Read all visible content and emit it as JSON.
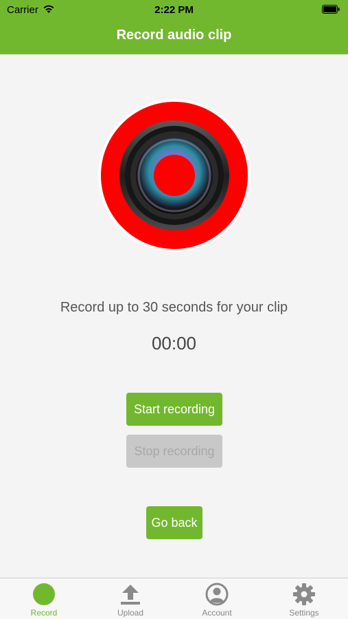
{
  "status_bar": {
    "carrier": "Carrier",
    "time": "2:22 PM"
  },
  "header": {
    "title": "Record audio clip"
  },
  "main": {
    "instruction": "Record up to 30 seconds for your clip",
    "timer": "00:00",
    "start_label": "Start recording",
    "stop_label": "Stop recording",
    "back_label": "Go back"
  },
  "tabs": [
    {
      "label": "Record",
      "icon": "record-dot-icon",
      "active": true
    },
    {
      "label": "Upload",
      "icon": "upload-icon",
      "active": false
    },
    {
      "label": "Account",
      "icon": "account-icon",
      "active": false
    },
    {
      "label": "Settings",
      "icon": "gear-icon",
      "active": false
    }
  ],
  "colors": {
    "accent": "#72b82e",
    "record_red": "#ff0000",
    "disabled": "#c8c8c8"
  }
}
